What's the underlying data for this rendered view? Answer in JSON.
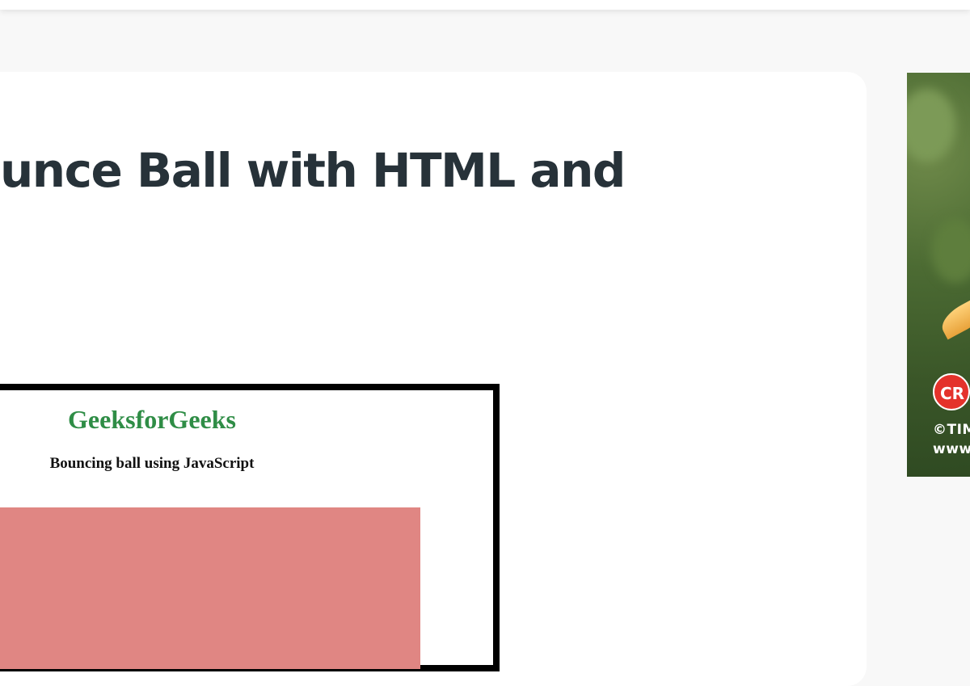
{
  "article": {
    "title": "unce Ball with HTML and"
  },
  "demo": {
    "heading": "GeeksforGeeks",
    "subheading": "Bouncing ball using JavaScript"
  },
  "ad": {
    "badge": "CR",
    "copyright_line": "©TIM",
    "url_line": "www"
  },
  "colors": {
    "page_background": "#f8f8f8",
    "title_text": "#273239",
    "gfg_green": "#2f8d46",
    "canvas_fill": "#e08683"
  }
}
